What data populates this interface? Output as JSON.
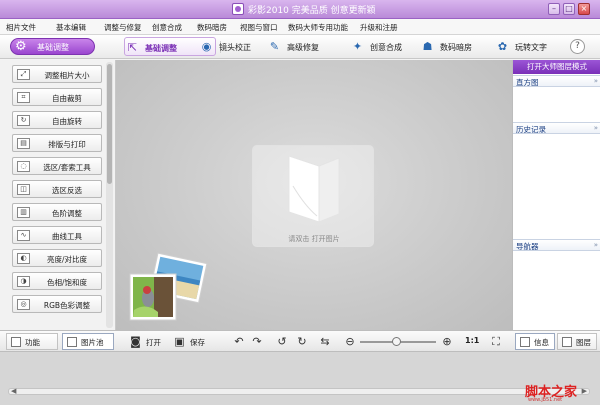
{
  "window": {
    "title": "彩影2010 完美品质 创意更新颖",
    "controls": {
      "minimize": "–",
      "maximize": "□",
      "close": "×"
    }
  },
  "menu": [
    "相片文件",
    "基本编辑",
    "调整与修复",
    "创意合成",
    "数码暗房",
    "视图与窗口",
    "数码大师专用功能",
    "升级和注册"
  ],
  "toolbar": {
    "basic_button": "基础调整",
    "tabs": [
      {
        "label": "基础调整",
        "icon": "crop-arrow-icon",
        "active": true
      },
      {
        "label": "镜头校正",
        "icon": "lens-icon"
      },
      {
        "label": "高级修复",
        "icon": "brush-icon"
      },
      {
        "label": "创意合成",
        "icon": "merge-icon"
      },
      {
        "label": "数码暗房",
        "icon": "darkroom-icon"
      },
      {
        "label": "玩转文字",
        "icon": "text-icon"
      }
    ],
    "help": "?"
  },
  "functions": [
    "调整相片大小",
    "自由裁剪",
    "自由旋转",
    "排版与打印",
    "选区/套索工具",
    "选区反选",
    "色阶调整",
    "曲线工具",
    "亮度/对比度",
    "色相/饱和度",
    "RGB色彩调整"
  ],
  "canvas": {
    "hint": "请双击 打开图片"
  },
  "right_panel": {
    "mode_button": "打开大师图层模式",
    "sections": [
      "直方图",
      "历史记录",
      "导航器"
    ]
  },
  "bottom": {
    "tabs": [
      "功能",
      "图片池"
    ],
    "open": "打开",
    "save": "保存",
    "ratio": "1:1",
    "right_tabs": [
      "信息",
      "图层"
    ]
  },
  "watermark": {
    "main": "脚本之家",
    "sub": "www.jb51.net"
  }
}
